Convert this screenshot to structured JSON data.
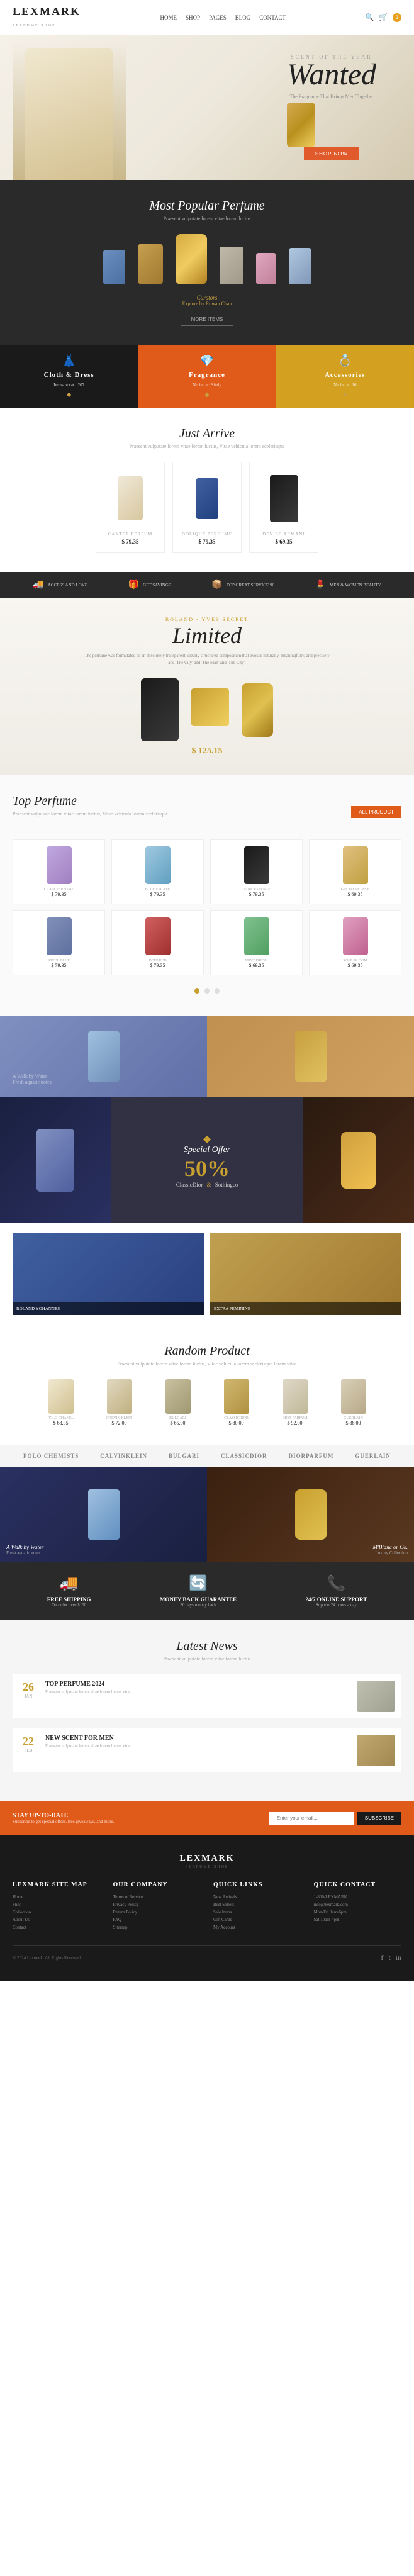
{
  "header": {
    "logo": "LEXMARK",
    "logo_sub": "PERFUME SHOP",
    "nav": [
      "HOME",
      "SHOP",
      "PAGES",
      "BLOG",
      "CONTACT"
    ],
    "cart_count": "2"
  },
  "hero": {
    "subtitle": "SCENT OF THE YEAR",
    "title": "Wanted",
    "description": "The Fragrance That Brings Men Together",
    "btn_label": "SHOP NOW"
  },
  "popular": {
    "title": "Most Popular Perfume",
    "subtitle": "Praesent vulputate lorem vitae lorem luctus",
    "curator_text": "Curators",
    "curator_name": "Explore by Rowan Chan",
    "more_btn": "MORE ITEMS"
  },
  "categories": [
    {
      "id": "cloth-dress",
      "title": "Cloth & Dress",
      "sub": "Items in cat · 207",
      "icon": "👗"
    },
    {
      "id": "fragrance",
      "title": "Fragrance",
      "sub": "No in cat: Sitely",
      "icon": "💎"
    },
    {
      "id": "accessories",
      "title": "Accessories",
      "sub": "No in cat: 10",
      "icon": "💍"
    }
  ],
  "just_arrive": {
    "title": "Just Arrive",
    "subtitle": "Praesent vulputate lorem vitae lorem luctus, Vitae vehicula lorem scelerisque"
  },
  "just_arrive_products": [
    {
      "name": "CANTER PERFUM",
      "price": "$ 79.35"
    },
    {
      "name": "DOLIQUE PERFUME",
      "price": "$ 79.35"
    },
    {
      "name": "DENISE ARMANI",
      "price": "$ 69.35"
    }
  ],
  "features_bar": [
    {
      "icon": "🚚",
      "text": "ACCESS AND LOVE"
    },
    {
      "icon": "🎁",
      "text": "GET SAVINGS"
    },
    {
      "icon": "📦",
      "text": "TOP GREAT SERVICE 96"
    },
    {
      "icon": "💄",
      "text": "MEN & WOMEN BEAUTY"
    }
  ],
  "limited": {
    "title": "Limited",
    "description": "The perfume was formulated as an absolutely transparent, clearly structured composition that evokes naturally, meaningfully, and precisely and 'The City' and 'The Man' and 'The City'.",
    "label": "ROLAND - YVES SECRET",
    "price": "$ 125.15"
  },
  "top_perfume": {
    "title": "Top Perfume",
    "subtitle": "Praesent vulputate lorem vitae lorem luctus, Vitae vehicula lorem scelerisque",
    "btn_label": "ALL PRODUCT"
  },
  "top_products": [
    {
      "name": "CLAIR PERFUME",
      "price": "$ 79.35",
      "bottle_class": "gb1"
    },
    {
      "name": "BLUE ESCAPE",
      "price": "$ 79.35",
      "bottle_class": "gb2"
    },
    {
      "name": "DARK ESSENCE",
      "price": "$ 79.35",
      "bottle_class": "gb3"
    },
    {
      "name": "GOLD FANTASY",
      "price": "$ 69.35",
      "bottle_class": "gb4"
    },
    {
      "name": "STEEL BLUE",
      "price": "$ 79.35",
      "bottle_class": "gb5"
    },
    {
      "name": "DEEP RED",
      "price": "$ 79.35",
      "bottle_class": "gb6"
    },
    {
      "name": "MINT FRESH",
      "price": "$ 69.35",
      "bottle_class": "gb7"
    },
    {
      "name": "ROSE BLOOM",
      "price": "$ 69.35",
      "bottle_class": "gb8"
    }
  ],
  "special_offer": {
    "diamond": "◆",
    "title": "Special Offer",
    "percent": "50%",
    "brand1": "ClassicDior",
    "brand2": "Sothingco",
    "connector": "&"
  },
  "random": {
    "title": "Random Product",
    "subtitle": "Praesent vulputate lorem vitae lorem luctus, Vitae vehicula lorem scelerisque lorem vitae"
  },
  "random_products": [
    {
      "name": "POLO CHANEL",
      "price": "$ 68.35"
    },
    {
      "name": "CALVIN KLEIN",
      "price": "$ 72.00"
    },
    {
      "name": "BULGARI",
      "price": "$ 65.00"
    },
    {
      "name": "CLASSIC DOR",
      "price": "$ 80.00"
    },
    {
      "name": "DIOR PARFUM",
      "price": "$ 92.00"
    },
    {
      "name": "GUERLAIN",
      "price": "$ 88.00"
    }
  ],
  "brands": [
    "POLO CHEMISTS",
    "CalvinKlein",
    "BULGARI",
    "ClassicDior",
    "Diorparfum",
    "GUERLAIN"
  ],
  "video": {
    "title": "A Walk by Water",
    "subtitle": "Fresh aquatic notes",
    "title2": "M'Blanc or Co.",
    "subtitle2": "Luxury Collection"
  },
  "feature_boxes": [
    {
      "icon": "🚚",
      "title": "FREE SHIPPING",
      "sub": "On order over $150"
    },
    {
      "icon": "🔄",
      "title": "MONEY BACK GUARANTEE",
      "sub": "30 days money back"
    },
    {
      "icon": "📞",
      "title": "24/7 ONLINE SUPPORT",
      "sub": "Support 24 hours a day"
    }
  ],
  "news": {
    "title": "Latest News",
    "subtitle": "Praesent vulputate lorem vitae lorem luctus"
  },
  "news_items": [
    {
      "day": "26",
      "month": "JAN",
      "title": "TOP PERFUME 2024",
      "text": "Praesent vulputate lorem vitae lorem luctus vitae..."
    },
    {
      "day": "22",
      "month": "FEB",
      "title": "NEW SCENT FOR MEN",
      "text": "Praesent vulputate lorem vitae lorem luctus vitae..."
    }
  ],
  "newsletter": {
    "title": "STAY UP-TO-DATE",
    "sub": "Subscribe to get special offers, free giveaways, and more.",
    "placeholder": "Enter your email...",
    "btn": "SUBSCRIBE"
  },
  "footer": {
    "logo": "LEXMARK",
    "columns": [
      {
        "title": "LEXMARK SITE MAP",
        "items": [
          "Home",
          "Shop",
          "Collection",
          "About Us",
          "Contact"
        ]
      },
      {
        "title": "OUR COMPANY",
        "items": [
          "Terms of Service",
          "Privacy Policy",
          "Return Policy",
          "FAQ",
          "Sitemap"
        ]
      },
      {
        "title": "QUICK LINKS",
        "items": [
          "New Arrivals",
          "Best Sellers",
          "Sale Items",
          "Gift Cards",
          "My Account"
        ]
      },
      {
        "title": "QUICK CONTACT",
        "items": [
          "1-800-LEXMARK",
          "info@lexmark.com",
          "Mon-Fri 9am-6pm",
          "Sat 10am-4pm"
        ]
      }
    ],
    "copy": "© 2024 Lexmark. All Rights Reserved."
  }
}
